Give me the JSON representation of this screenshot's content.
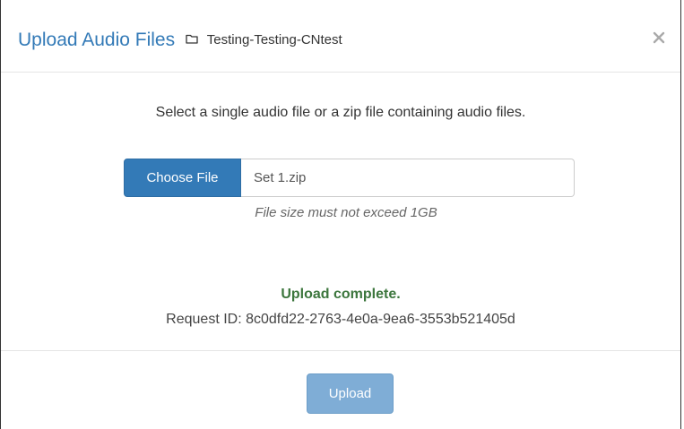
{
  "dialog": {
    "title": "Upload Audio Files",
    "folder_icon": "folder-icon",
    "folder_name": "Testing-Testing-CNtest",
    "close_icon": "close-icon"
  },
  "body": {
    "instructions": "Select a single audio file or a zip file containing audio files.",
    "choose_file_label": "Choose File",
    "selected_file": "Set 1.zip",
    "size_note": "File size must not exceed 1GB",
    "status": "Upload complete.",
    "request_id": "Request ID: 8c0dfd22-2763-4e0a-9ea6-3553b521405d"
  },
  "footer": {
    "upload_label": "Upload",
    "upload_disabled": true
  },
  "colors": {
    "title": "#337ab7",
    "primary_button": "#337ab7",
    "success_text": "#3c763d",
    "disabled_button": "#7fadd6"
  }
}
